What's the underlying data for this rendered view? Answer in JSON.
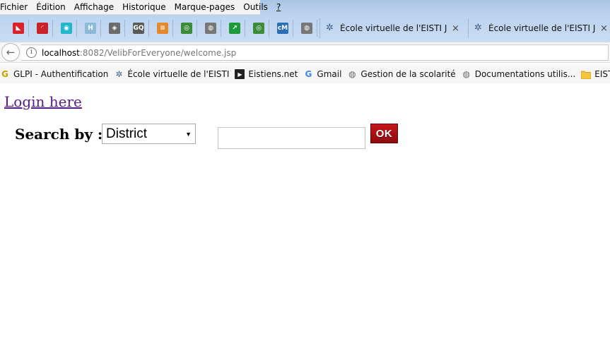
{
  "menubar": {
    "items": [
      "Fichier",
      "Édition",
      "Affichage",
      "Historique",
      "Marque-pages",
      "Outils",
      "?"
    ]
  },
  "pinned_tabs": [
    {
      "icon": "app-red-icon",
      "color": "#d8232a",
      "glyph": "◣"
    },
    {
      "icon": "app-red-arc-icon",
      "color": "#c9222a",
      "glyph": "◜"
    },
    {
      "icon": "owl-icon",
      "color": "#23b5c9",
      "glyph": "◉"
    },
    {
      "icon": "h-app-icon",
      "color": "#8fb9d8",
      "glyph": "H"
    },
    {
      "icon": "diamond-icon",
      "color": "#6b6b6b",
      "glyph": "◈"
    },
    {
      "icon": "goodreads-icon",
      "color": "#5a5a5a",
      "glyph": "GQ"
    },
    {
      "icon": "stackoverflow-icon",
      "color": "#e48a2c",
      "glyph": "≡"
    },
    {
      "icon": "chrome-like-icon",
      "color": "#3b8b3b",
      "glyph": "◎"
    },
    {
      "icon": "globe-icon",
      "color": "#777777",
      "glyph": "◍"
    },
    {
      "icon": "chart-icon",
      "color": "#1f9a3a",
      "glyph": "↗"
    },
    {
      "icon": "chrome-like-icon-2",
      "color": "#3b8b3b",
      "glyph": "◎"
    },
    {
      "icon": "cm-app-icon",
      "color": "#2a6fb5",
      "glyph": "cM"
    },
    {
      "icon": "globe-icon-2",
      "color": "#777777",
      "glyph": "◍"
    }
  ],
  "tabs": [
    {
      "title": "École virtuelle de l'EISTI Jak...",
      "close": "×"
    },
    {
      "title": "École virtuelle de l'EISTI Jak...",
      "close": "×"
    }
  ],
  "navbar": {
    "url_host": "localhost",
    "url_path": ":8082/VelibForEveryone/welcome.jsp"
  },
  "bookmarks": [
    {
      "label": "GLPI - Authentification",
      "icon": "glpi-icon"
    },
    {
      "label": "École virtuelle de l'EISTI",
      "icon": "eisti-icon"
    },
    {
      "label": "Eistiens.net",
      "icon": "terminal-icon"
    },
    {
      "label": "Gmail",
      "icon": "google-icon"
    },
    {
      "label": "Gestion de la scolarité",
      "icon": "globe-icon"
    },
    {
      "label": "Documentations utilis...",
      "icon": "globe-icon"
    },
    {
      "label": "EISTI",
      "icon": "folder-icon"
    }
  ],
  "page": {
    "login_link": "Login here",
    "search_label": "Search by :",
    "select_value": "District",
    "search_value": "",
    "ok_label": "OK"
  }
}
